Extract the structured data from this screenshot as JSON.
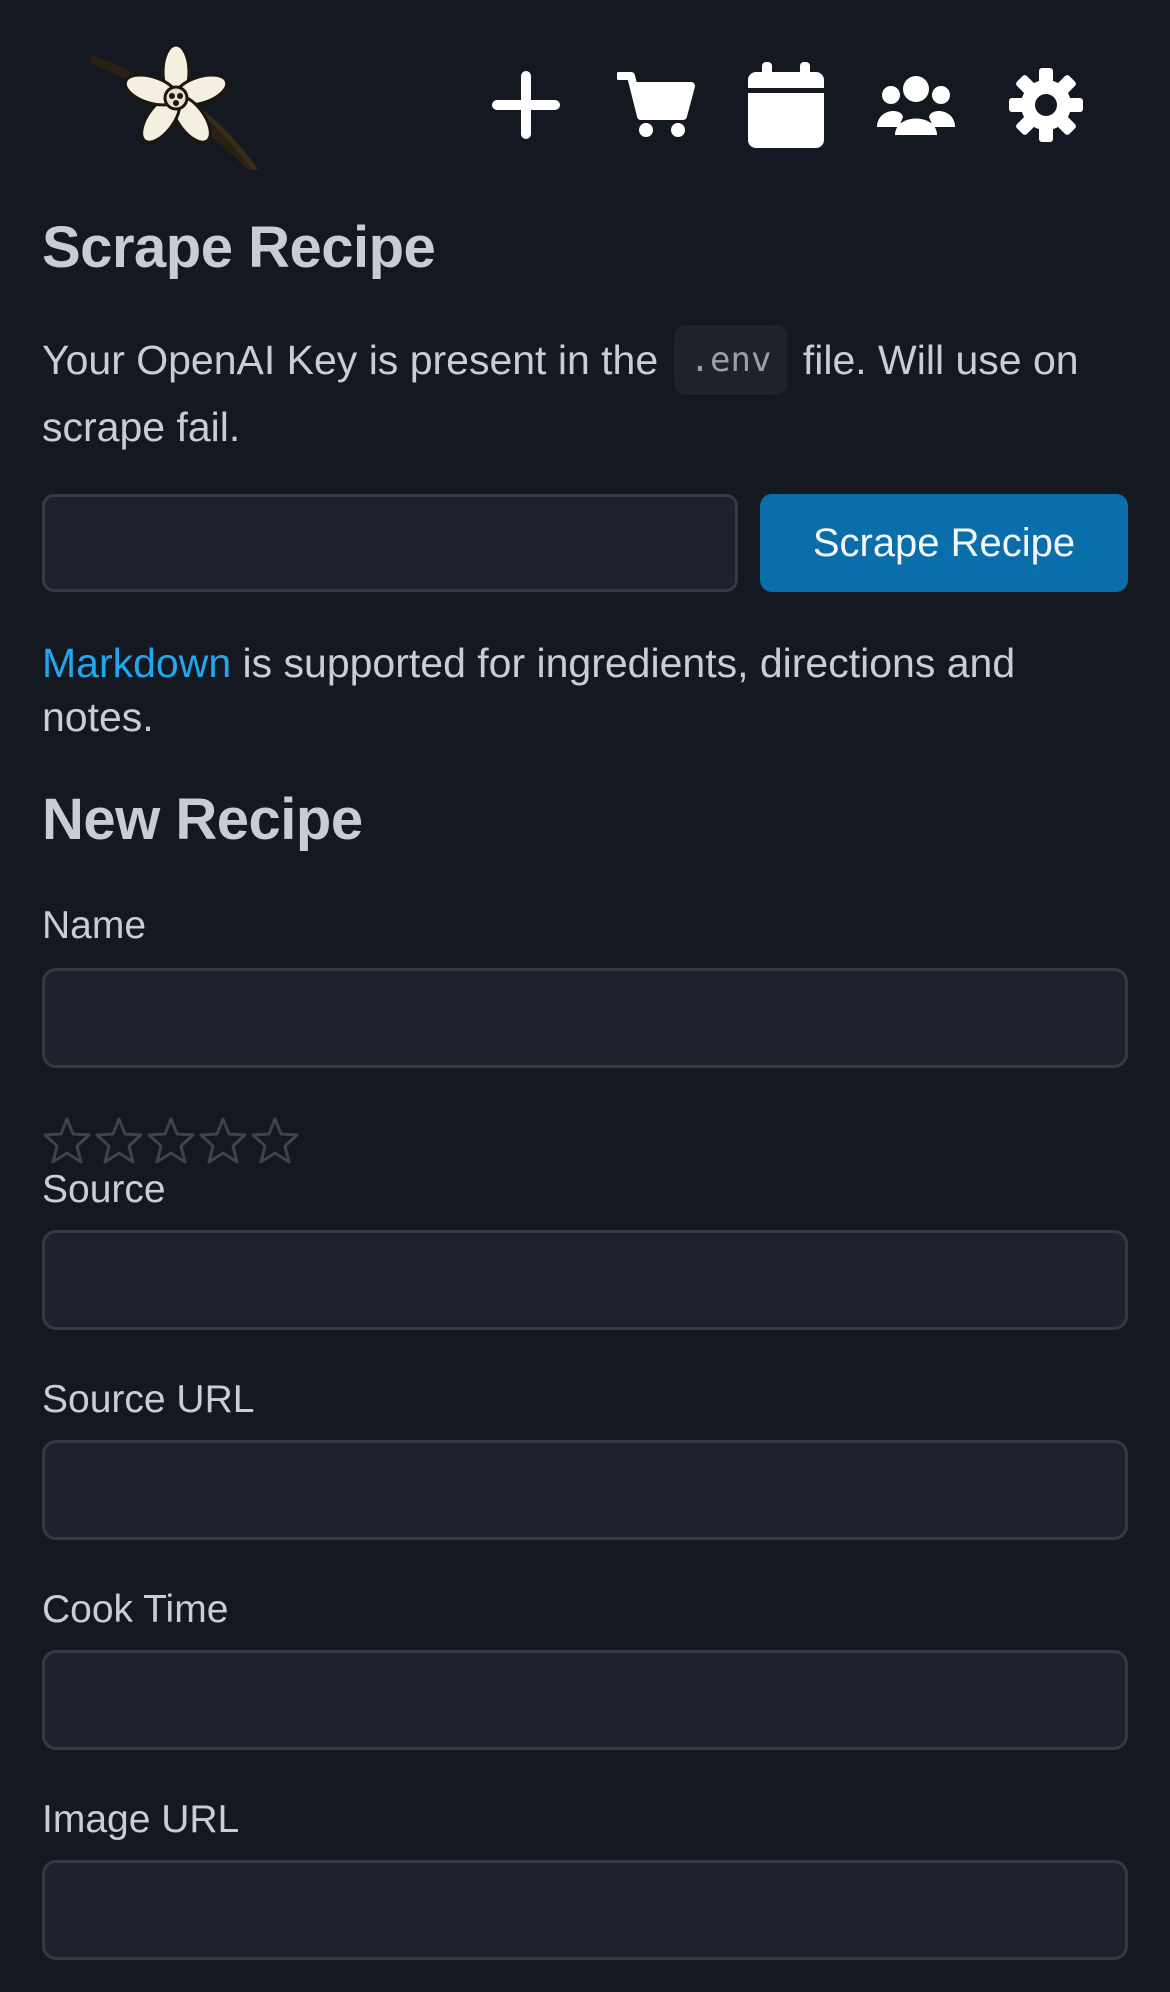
{
  "header": {
    "logo_name": "vanilla-flower-logo",
    "nav": [
      {
        "name": "add-recipe-button",
        "icon": "plus-icon"
      },
      {
        "name": "shopping-cart-button",
        "icon": "cart-icon"
      },
      {
        "name": "calendar-button",
        "icon": "calendar-icon"
      },
      {
        "name": "users-button",
        "icon": "users-icon"
      },
      {
        "name": "settings-button",
        "icon": "gear-icon"
      }
    ]
  },
  "scrape": {
    "title": "Scrape Recipe",
    "info_before": "Your OpenAI Key is present in the",
    "info_code": ".env",
    "info_after": "file. Will use on scrape fail.",
    "url_value": "",
    "button_label": "Scrape Recipe"
  },
  "markdown_note": {
    "link_text": "Markdown",
    "rest": " is supported for ingredients, directions and notes."
  },
  "new_recipe": {
    "title": "New Recipe",
    "rating": 0,
    "rating_max": 5,
    "fields": {
      "name": {
        "label": "Name",
        "value": ""
      },
      "source": {
        "label": "Source",
        "value": ""
      },
      "source_url": {
        "label": "Source URL",
        "value": ""
      },
      "cook_time": {
        "label": "Cook Time",
        "value": ""
      },
      "image_url": {
        "label": "Image URL",
        "value": ""
      }
    }
  },
  "colors": {
    "background": "#141820",
    "accent": "#0a6eaa",
    "link": "#22a6ef",
    "input_bg": "#1e222d",
    "star_outline": "#3e4350"
  }
}
